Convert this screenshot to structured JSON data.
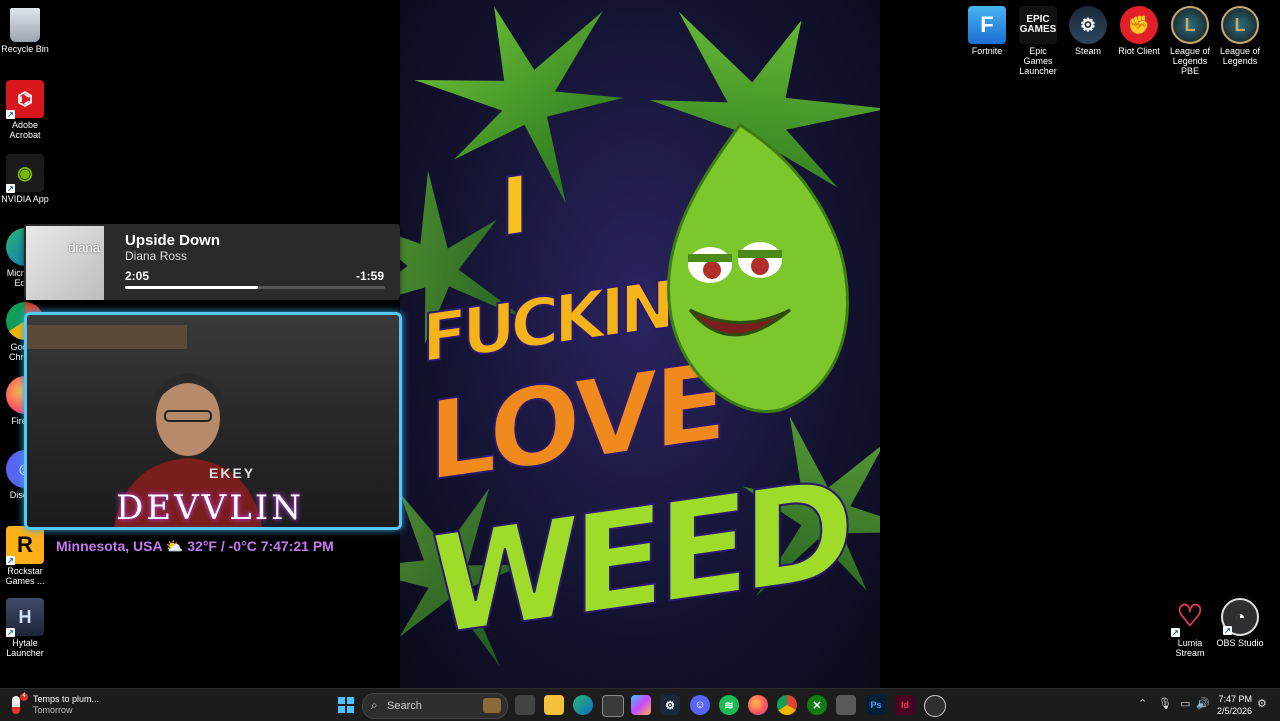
{
  "desktop": {
    "left_icons": [
      {
        "label": "Recycle Bin",
        "icon": "recycle-bin-icon"
      },
      {
        "label": "Adobe Acrobat",
        "icon": "acrobat-icon"
      },
      {
        "label": "NVIDIA App",
        "icon": "nvidia-icon"
      },
      {
        "label": "Microsoft Edge",
        "icon": "edge-icon"
      },
      {
        "label": "Google Chrome",
        "icon": "chrome-icon"
      },
      {
        "label": "Firefox",
        "icon": "firefox-icon"
      },
      {
        "label": "Discord",
        "icon": "discord-icon"
      },
      {
        "label": "Rockstar Games ...",
        "icon": "rockstar-icon"
      },
      {
        "label": "Hytale Launcher",
        "icon": "hytale-icon"
      }
    ],
    "top_right_icons": [
      {
        "label": "Fortnite",
        "icon": "fortnite-icon"
      },
      {
        "label": "Epic Games Launcher",
        "icon": "epic-games-icon"
      },
      {
        "label": "Steam",
        "icon": "steam-icon"
      },
      {
        "label": "Riot Client",
        "icon": "riot-icon"
      },
      {
        "label": "League of Legends PBE",
        "icon": "league-pbe-icon"
      },
      {
        "label": "League of Legends",
        "icon": "league-icon"
      }
    ],
    "bottom_right_icons": [
      {
        "label": "Lumia Stream",
        "icon": "lumia-icon"
      },
      {
        "label": "OBS Studio",
        "icon": "obs-icon"
      }
    ],
    "epic_logo_text": "EPIC\nGAMES"
  },
  "wallpaper": {
    "words": [
      "I",
      "FUCKING",
      "LOVE",
      "WEED"
    ]
  },
  "now_playing": {
    "title": "Upside Down",
    "artist": "Diana Ross",
    "elapsed": "2:05",
    "remaining": "-1:59",
    "progress": 0.51,
    "album_text": "diana"
  },
  "webcam": {
    "streamer_name": "DEVVLIN",
    "shirt_text": "EKEY",
    "weather_line": "Minnesota, USA ⛅ 32°F / -0°C  7:47:21 PM"
  },
  "taskbar": {
    "notification_title": "Temps to plum...",
    "notification_sub": "Tomorrow",
    "search_placeholder": "Search",
    "time": "7:47 PM",
    "date": "2/5/2026",
    "pinned": [
      "task-view",
      "file-explorer",
      "edge",
      "store",
      "copilot",
      "steam",
      "discord",
      "spotify",
      "firefox",
      "chrome",
      "xbox",
      "app",
      "photoshop",
      "indesign",
      "obs"
    ]
  },
  "colors": {
    "accent_cyan": "#57c7f5",
    "weather_purple": "#c67af0",
    "taskbar_bg": "#1c1c1c"
  }
}
